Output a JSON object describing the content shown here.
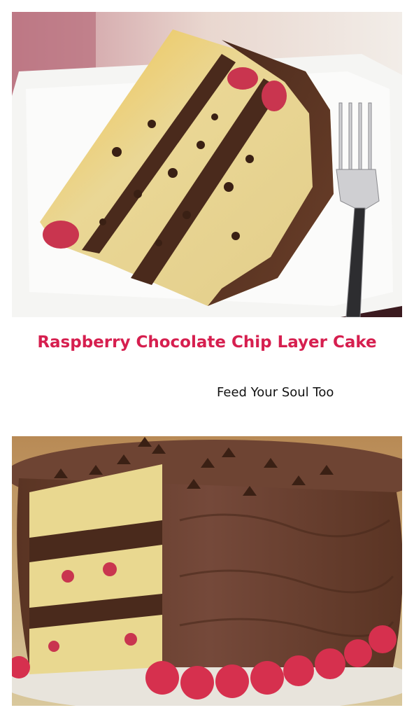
{
  "title": "Raspberry Chocolate Chip Layer Cake",
  "credit": "Feed Your Soul Too",
  "colors": {
    "title": "#d61f4f",
    "credit": "#111111",
    "frosting": "#5a3423",
    "cake": "#e6d08c",
    "raspberry": "#d6304e",
    "plate": "#f4f4f2"
  },
  "images": [
    {
      "subject": "slice-of-layer-cake-on-white-plate-with-fork"
    },
    {
      "subject": "whole-frosted-layer-cake-with-raspberries"
    }
  ]
}
